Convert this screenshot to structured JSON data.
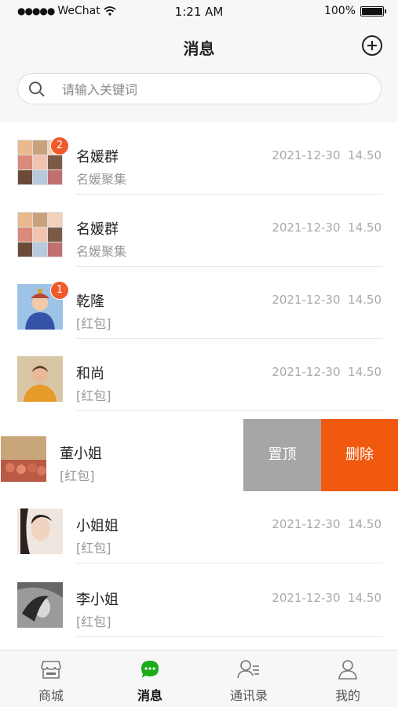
{
  "status_bar": {
    "carrier": "WeChat",
    "time": "1:21 AM",
    "battery": "100%"
  },
  "header": {
    "title": "消息",
    "add_icon": "plus-circle-icon"
  },
  "search": {
    "placeholder": "请输入关键词",
    "icon": "search-icon"
  },
  "conversations": [
    {
      "name": "名媛群",
      "preview": "名媛聚集",
      "time": "2021-12-30  14.50",
      "badge": "2",
      "avatar": "group-avatar"
    },
    {
      "name": "名媛群",
      "preview": "名媛聚集",
      "time": "2021-12-30  14.50",
      "badge": "",
      "avatar": "group-avatar"
    },
    {
      "name": "乾隆",
      "preview": "[红包]",
      "time": "2021-12-30  14.50",
      "badge": "1",
      "avatar": "person-avatar"
    },
    {
      "name": "和尚",
      "preview": "[红包]",
      "time": "2021-12-30  14.50",
      "badge": "",
      "avatar": "person-avatar"
    },
    {
      "name": "董小姐",
      "preview": "[红包]",
      "time": "",
      "badge": "",
      "avatar": "photo-avatar"
    },
    {
      "name": "小姐姐",
      "preview": "[红包]",
      "time": "2021-12-30  14.50",
      "badge": "",
      "avatar": "person-avatar"
    },
    {
      "name": "李小姐",
      "preview": "[红包]",
      "time": "2021-12-30  14.50",
      "badge": "",
      "avatar": "person-avatar"
    }
  ],
  "swipe_actions": {
    "pin_label": "置顶",
    "delete_label": "删除",
    "pin_color": "#a6a6a6",
    "delete_color": "#f1590f"
  },
  "tabs": [
    {
      "label": "商城",
      "icon": "store-icon",
      "active": false
    },
    {
      "label": "消息",
      "icon": "chat-bubble-icon",
      "active": true
    },
    {
      "label": "通讯录",
      "icon": "contacts-icon",
      "active": false
    },
    {
      "label": "我的",
      "icon": "profile-icon",
      "active": false
    }
  ],
  "colors": {
    "accent_green": "#1aad19",
    "badge_red": "#f1592a"
  }
}
